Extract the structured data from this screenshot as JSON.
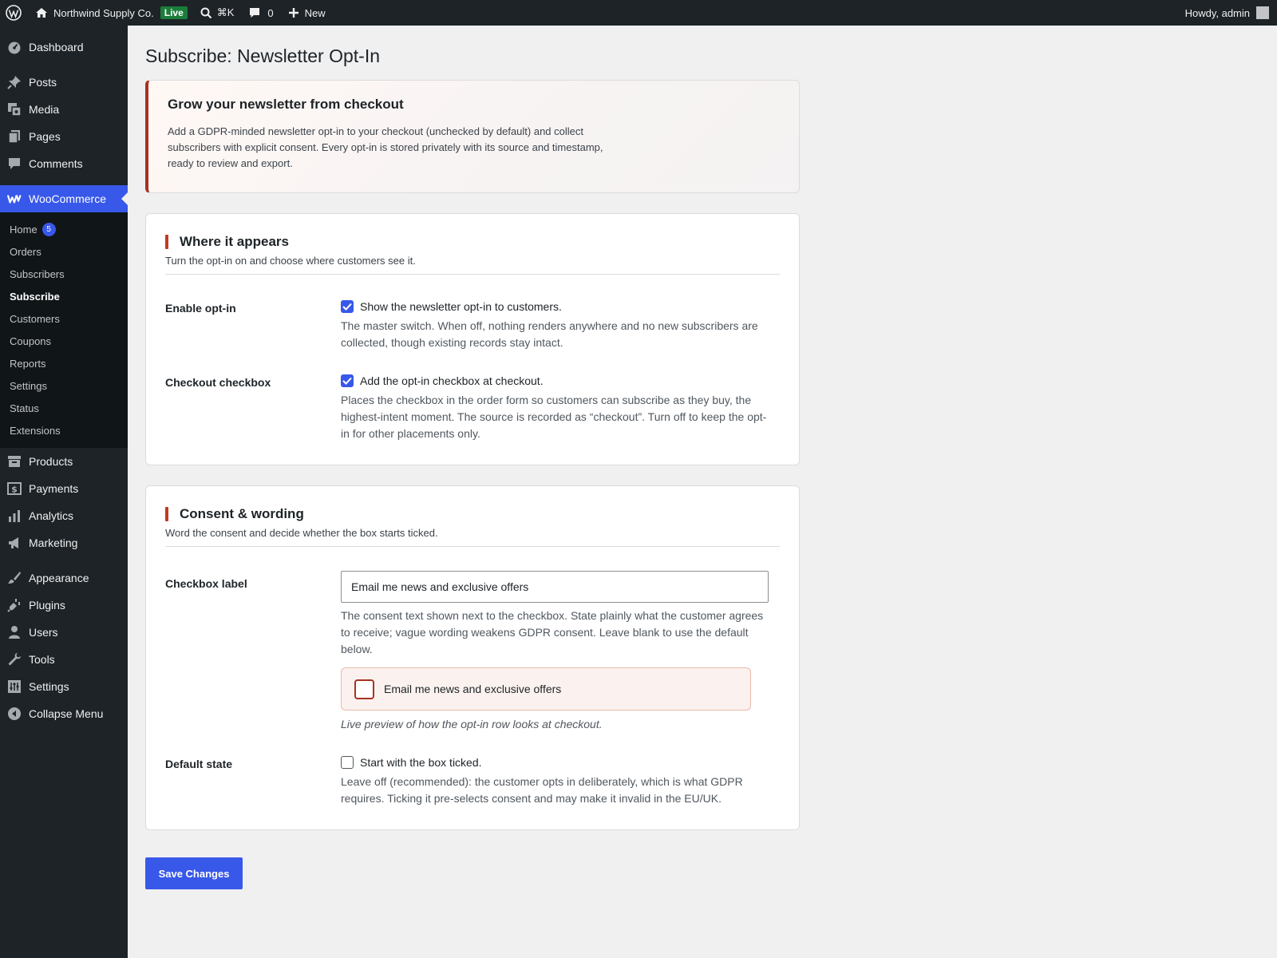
{
  "adminbar": {
    "site_name": "Northwind Supply Co.",
    "live_badge": "Live",
    "search_shortcut": "⌘K",
    "comments_count": "0",
    "new_label": "New",
    "howdy": "Howdy, admin"
  },
  "sidebar": {
    "top_items": [
      {
        "label": "Dashboard"
      },
      {
        "label": "Posts"
      },
      {
        "label": "Media"
      },
      {
        "label": "Pages"
      },
      {
        "label": "Comments"
      },
      {
        "label": "WooCommerce"
      }
    ],
    "woo_sub": [
      {
        "label": "Home",
        "badge": "5"
      },
      {
        "label": "Orders"
      },
      {
        "label": "Subscribers"
      },
      {
        "label": "Subscribe"
      },
      {
        "label": "Customers"
      },
      {
        "label": "Coupons"
      },
      {
        "label": "Reports"
      },
      {
        "label": "Settings"
      },
      {
        "label": "Status"
      },
      {
        "label": "Extensions"
      }
    ],
    "bottom_items": [
      {
        "label": "Products"
      },
      {
        "label": "Payments"
      },
      {
        "label": "Analytics"
      },
      {
        "label": "Marketing"
      },
      {
        "label": "Appearance"
      },
      {
        "label": "Plugins"
      },
      {
        "label": "Users"
      },
      {
        "label": "Tools"
      },
      {
        "label": "Settings"
      },
      {
        "label": "Collapse Menu"
      }
    ]
  },
  "page": {
    "title": "Subscribe: Newsletter Opt-In",
    "intro_title": "Grow your newsletter from checkout",
    "intro_text": "Add a GDPR-minded newsletter opt-in to your checkout (unchecked by default) and collect subscribers with explicit consent. Every opt-in is stored privately with its source and timestamp, ready to review and export."
  },
  "where": {
    "title": "Where it appears",
    "subtitle": "Turn the opt-in on and choose where customers see it.",
    "enable_label": "Enable opt-in",
    "enable_checkbox": "Show the newsletter opt-in to customers.",
    "enable_desc": "The master switch. When off, nothing renders anywhere and no new subscribers are collected, though existing records stay intact.",
    "checkout_label": "Checkout checkbox",
    "checkout_checkbox": "Add the opt-in checkbox at checkout.",
    "checkout_desc": "Places the checkbox in the order form so customers can subscribe as they buy, the highest-intent moment. The source is recorded as “checkout”. Turn off to keep the opt-in for other placements only."
  },
  "consent": {
    "title": "Consent & wording",
    "subtitle": "Word the consent and decide whether the box starts ticked.",
    "label_label": "Checkbox label",
    "label_value": "Email me news and exclusive offers",
    "label_desc": "The consent text shown next to the checkbox. State plainly what the customer agrees to receive; vague wording weakens GDPR consent. Leave blank to use the default below.",
    "preview_text": "Email me news and exclusive offers",
    "preview_caption": "Live preview of how the opt-in row looks at checkout.",
    "default_label": "Default state",
    "default_checkbox": "Start with the box ticked.",
    "default_desc": "Leave off (recommended): the customer opts in deliberately, which is what GDPR requires. Ticking it pre-selects consent and may make it invalid in the EU/UK."
  },
  "actions": {
    "save": "Save Changes"
  }
}
